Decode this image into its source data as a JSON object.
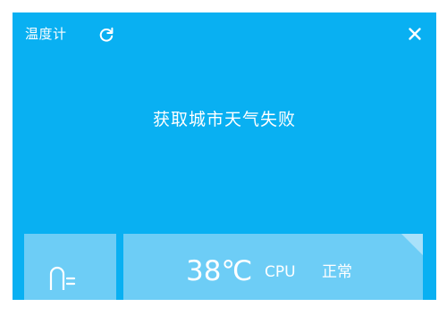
{
  "window": {
    "title": "温度计",
    "accent_color": "#09b0f2",
    "tile_color": "#6dcdf6",
    "icons": {
      "refresh": "refresh-icon",
      "close": "close-icon",
      "thermometer": "thermometer-icon"
    }
  },
  "weather": {
    "message": "获取城市天气失败"
  },
  "cpu": {
    "temperature": "38℃",
    "label": "CPU",
    "status": "正常"
  }
}
